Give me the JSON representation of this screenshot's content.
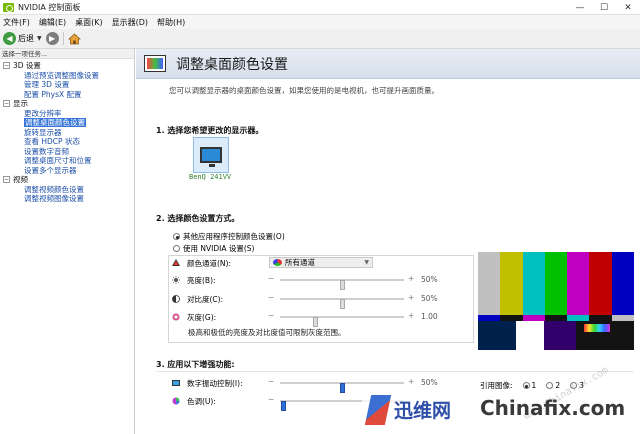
{
  "window": {
    "title": "NVIDIA 控制面板",
    "controls": [
      "—",
      "☐",
      "✕"
    ]
  },
  "menubar": {
    "items": [
      "文件(F)",
      "编辑(E)",
      "桌面(K)",
      "显示器(D)",
      "帮助(H)"
    ]
  },
  "toolbar": {
    "back_label": "后退",
    "back_icon": "back-arrow-icon",
    "forward_icon": "forward-arrow-icon",
    "home_icon": "home-icon"
  },
  "sidebar": {
    "task_header": "选择一项任务...",
    "categories": [
      {
        "label": "3D 设置",
        "expander": "−",
        "items": [
          "通过预览调整图像设置",
          "管理 3D 设置",
          "配置 PhysX 配置"
        ]
      },
      {
        "label": "显示",
        "expander": "−",
        "items": [
          "更改分辨率",
          "调整桌面颜色设置",
          "旋转显示器",
          "查看 HDCP 状态",
          "设置数字音频",
          "调整桌面尺寸和位置",
          "设置多个显示器"
        ]
      },
      {
        "label": "视频",
        "expander": "−",
        "items": [
          "调整视频颜色设置",
          "调整视频图像设置"
        ]
      }
    ],
    "selected_item": "调整桌面颜色设置"
  },
  "main": {
    "title": "调整桌面颜色设置",
    "description": "您可以调整显示器的桌面颜色设置，如果您使用的是电视机，也可提升画面质量。",
    "section1": {
      "title": "1. 选择您希望更改的显示器。",
      "display_name": "BenQ 241VV"
    },
    "section2": {
      "title": "2. 选择颜色设置方式。",
      "option_app": "其他应用程序控制颜色设置(O)",
      "option_nvidia": "使用 NVIDIA 设置(S)",
      "selected_option": "option_app",
      "channel_label": "颜色通道(N):",
      "channel_value": "所有通道",
      "sliders": [
        {
          "name": "brightness",
          "label": "亮度(B):",
          "value": "50%",
          "fraction": 0.5
        },
        {
          "name": "contrast",
          "label": "对比度(C):",
          "value": "50%",
          "fraction": 0.5
        },
        {
          "name": "gamma",
          "label": "灰度(G):",
          "value": "1.00",
          "fraction": 0.29
        }
      ],
      "note": "极高和极低的亮度及对比度值可限制灰度范围。"
    },
    "section3": {
      "title": "3. 应用以下增强功能:",
      "sliders": [
        {
          "name": "digital-vibrance",
          "label": "数字振动控制(I):",
          "value": "50%",
          "fraction": 0.5
        },
        {
          "name": "hue",
          "label": "色调(U):",
          "value": "",
          "fraction": 0.03
        }
      ],
      "reference_label": "引用图像:",
      "reference_options": [
        "1",
        "2",
        "3"
      ],
      "reference_selected": "1"
    }
  },
  "color_bars": {
    "top": [
      "#c0c0c0",
      "#c0c000",
      "#00c0c0",
      "#00c000",
      "#c000c0",
      "#c00000",
      "#0000c0"
    ],
    "middle": [
      "#0000c0",
      "#131313",
      "#c000c0",
      "#131313",
      "#00c0c0",
      "#131313",
      "#c0c0c0"
    ],
    "bottom": [
      "#00214c",
      "#ffffff",
      "#32006a",
      "#131313"
    ]
  },
  "watermark": {
    "diagonal": "www.Chinafix.com",
    "logo_cn": "迅维网",
    "logo_en": "Chinafix.com"
  }
}
